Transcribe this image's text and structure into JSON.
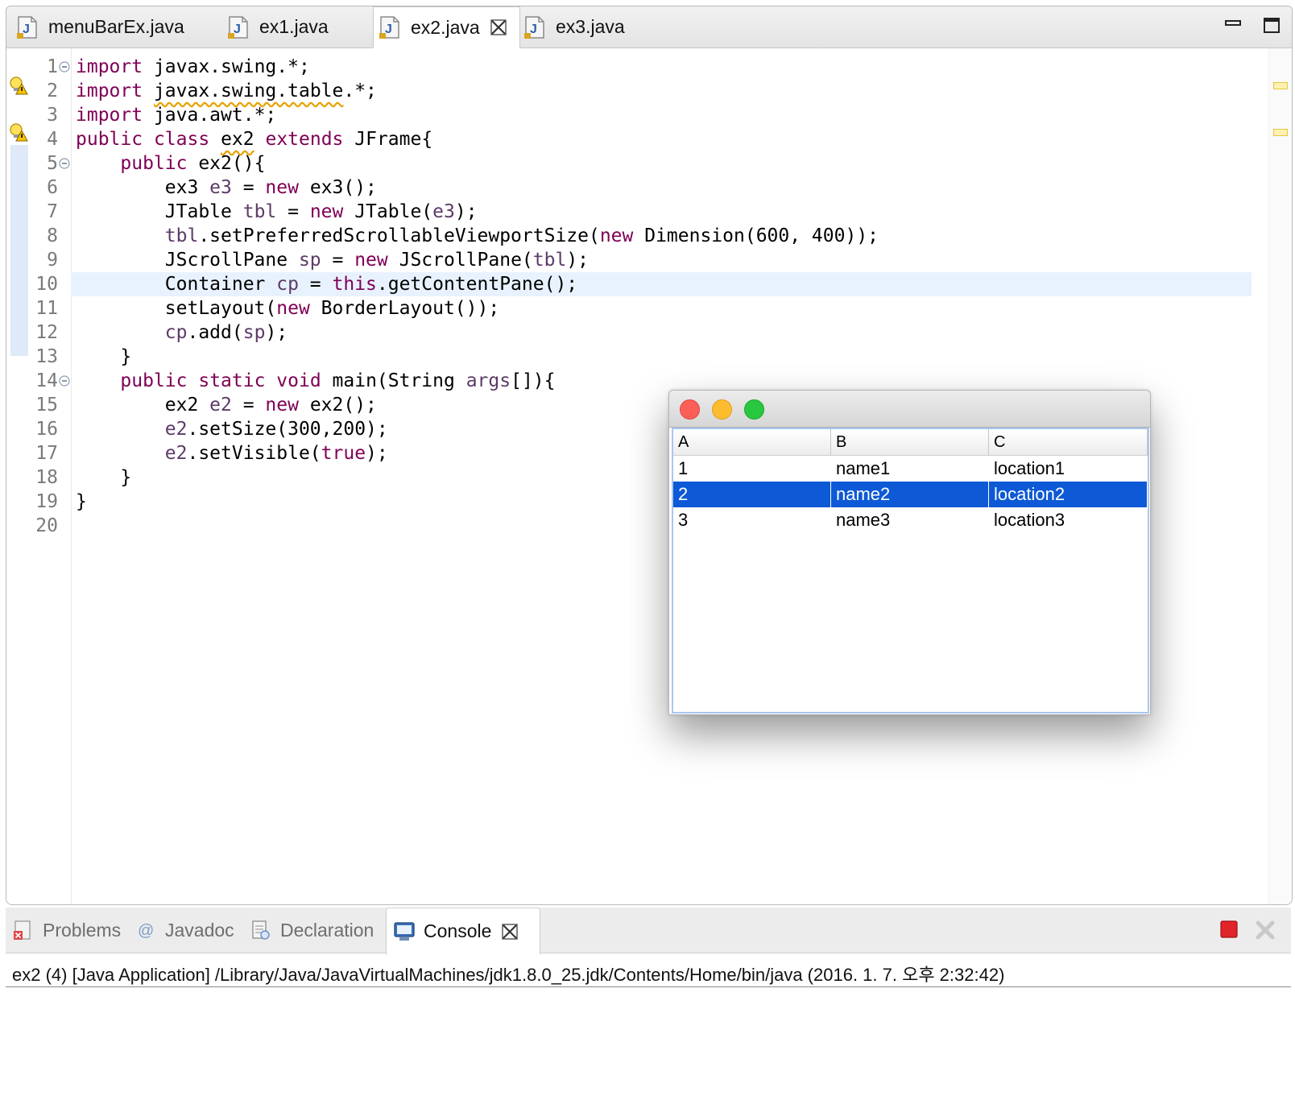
{
  "editor_tabs": [
    {
      "label": "menuBarEx.java"
    },
    {
      "label": "ex1.java"
    },
    {
      "label": "ex2.java",
      "active": true
    },
    {
      "label": "ex3.java"
    }
  ],
  "line_numbers": [
    "1",
    "2",
    "3",
    "4",
    "5",
    "6",
    "7",
    "8",
    "9",
    "10",
    "11",
    "12",
    "13",
    "14",
    "15",
    "16",
    "17",
    "18",
    "19",
    "20"
  ],
  "current_line": 10,
  "code_lines": [
    [
      {
        "t": "import",
        "c": "kw"
      },
      {
        "t": " javax.swing.*;"
      }
    ],
    [
      {
        "t": "import",
        "c": "kw"
      },
      {
        "t": " "
      },
      {
        "t": "javax.swing.table",
        "c": "wv"
      },
      {
        "t": ".*;"
      }
    ],
    [
      {
        "t": "import",
        "c": "kw"
      },
      {
        "t": " java.awt.*;"
      }
    ],
    [
      {
        "t": "public",
        "c": "kw"
      },
      {
        "t": " "
      },
      {
        "t": "class",
        "c": "kw"
      },
      {
        "t": " "
      },
      {
        "t": "ex2",
        "c": "wv"
      },
      {
        "t": " "
      },
      {
        "t": "extends",
        "c": "kw"
      },
      {
        "t": " JFrame{"
      }
    ],
    [
      {
        "t": "    "
      },
      {
        "t": "public",
        "c": "kw"
      },
      {
        "t": " ex2(){"
      }
    ],
    [
      {
        "t": "        ex3 "
      },
      {
        "t": "e3",
        "c": "var"
      },
      {
        "t": " = "
      },
      {
        "t": "new",
        "c": "kw"
      },
      {
        "t": " ex3();"
      }
    ],
    [
      {
        "t": "        JTable "
      },
      {
        "t": "tbl",
        "c": "var"
      },
      {
        "t": " = "
      },
      {
        "t": "new",
        "c": "kw"
      },
      {
        "t": " JTable("
      },
      {
        "t": "e3",
        "c": "var"
      },
      {
        "t": ");"
      }
    ],
    [
      {
        "t": "        "
      },
      {
        "t": "tbl",
        "c": "var"
      },
      {
        "t": ".setPreferredScrollableViewportSize("
      },
      {
        "t": "new",
        "c": "kw"
      },
      {
        "t": " Dimension(600, 400));"
      }
    ],
    [
      {
        "t": "        JScrollPane "
      },
      {
        "t": "sp",
        "c": "var"
      },
      {
        "t": " = "
      },
      {
        "t": "new",
        "c": "kw"
      },
      {
        "t": " JScrollPane("
      },
      {
        "t": "tbl",
        "c": "var"
      },
      {
        "t": ");"
      }
    ],
    [
      {
        "t": "        Container "
      },
      {
        "t": "cp",
        "c": "var"
      },
      {
        "t": " = "
      },
      {
        "t": "this",
        "c": "kw"
      },
      {
        "t": ".getContentPane();"
      }
    ],
    [
      {
        "t": "        setLayout("
      },
      {
        "t": "new",
        "c": "kw"
      },
      {
        "t": " BorderLayout());"
      }
    ],
    [
      {
        "t": "        "
      },
      {
        "t": "cp",
        "c": "var"
      },
      {
        "t": ".add("
      },
      {
        "t": "sp",
        "c": "var"
      },
      {
        "t": ");"
      }
    ],
    [
      {
        "t": "    }"
      }
    ],
    [
      {
        "t": "    "
      },
      {
        "t": "public",
        "c": "kw"
      },
      {
        "t": " "
      },
      {
        "t": "static",
        "c": "kw"
      },
      {
        "t": " "
      },
      {
        "t": "void",
        "c": "kw"
      },
      {
        "t": " main(String "
      },
      {
        "t": "args",
        "c": "var"
      },
      {
        "t": "[]){"
      }
    ],
    [
      {
        "t": "        ex2 "
      },
      {
        "t": "e2",
        "c": "var"
      },
      {
        "t": " = "
      },
      {
        "t": "new",
        "c": "kw"
      },
      {
        "t": " ex2();"
      }
    ],
    [
      {
        "t": "        "
      },
      {
        "t": "e2",
        "c": "var"
      },
      {
        "t": ".setSize(300,200);"
      }
    ],
    [
      {
        "t": "        "
      },
      {
        "t": "e2",
        "c": "var"
      },
      {
        "t": ".setVisible("
      },
      {
        "t": "true",
        "c": "kw"
      },
      {
        "t": ");"
      }
    ],
    [
      {
        "t": "    }"
      }
    ],
    [
      {
        "t": "}"
      }
    ],
    [
      {
        "t": ""
      }
    ]
  ],
  "console_tabs": [
    {
      "label": "Problems",
      "icon": "problems-icon"
    },
    {
      "label": "Javadoc",
      "icon": "javadoc-icon"
    },
    {
      "label": "Declaration",
      "icon": "declaration-icon"
    },
    {
      "label": "Console",
      "icon": "console-icon",
      "active": true
    }
  ],
  "console_info": "ex2 (4) [Java Application] /Library/Java/JavaVirtualMachines/jdk1.8.0_25.jdk/Contents/Home/bin/java (2016. 1. 7. 오후 2:32:42)",
  "swing_table": {
    "columns": [
      "A",
      "B",
      "C"
    ],
    "rows": [
      [
        "1",
        "name1",
        "location1"
      ],
      [
        "2",
        "name2",
        "location2"
      ],
      [
        "3",
        "name3",
        "location3"
      ]
    ],
    "selected_row": 2
  },
  "colors": {
    "keyword": "#7f0055",
    "selection": "#0d59d6",
    "current_line": "#e8f2fe",
    "close_light": "#fc5f57",
    "minimize_light": "#fdbc2e",
    "zoom_light": "#28c840",
    "terminate": "#e0242a"
  }
}
